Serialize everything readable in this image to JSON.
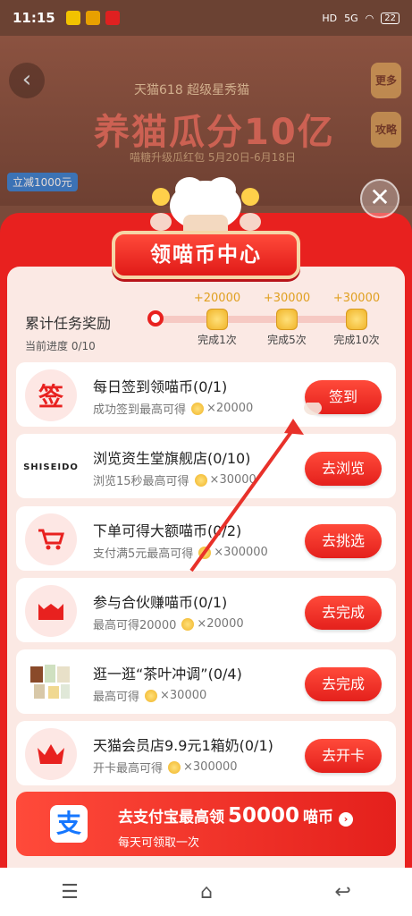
{
  "status_bar": {
    "time": "11:15",
    "network": "5G",
    "battery": "22"
  },
  "banner": {
    "subtitle": "天猫618 超级星秀猫",
    "title": "养猫瓜分10亿",
    "date": "喵糖升级瓜红包 5月20日-6月18日",
    "side_more": "更多",
    "side_strategy": "攻略",
    "discount_tag": "立减1000元"
  },
  "modal": {
    "title": "领喵币中心",
    "progress": {
      "title": "累计任务奖励",
      "current": "当前进度 0/10",
      "milestones": [
        {
          "amount": "+20000",
          "condition": "完成1次"
        },
        {
          "amount": "+30000",
          "condition": "完成5次"
        },
        {
          "amount": "+30000",
          "condition": "完成10次"
        }
      ]
    },
    "tasks": [
      {
        "name": "每日签到领喵币(0/1)",
        "desc": "成功签到最高可得",
        "reward": "×20000",
        "button": "签到",
        "icon": "签"
      },
      {
        "name": "浏览资生堂旗舰店(0/10)",
        "desc": "浏览15秒最高可得",
        "reward": "×30000",
        "button": "去浏览",
        "icon": "SHISEIDO"
      },
      {
        "name": "下单可得大额喵币(0/2)",
        "desc": "支付满5元最高可得",
        "reward": "×300000",
        "button": "去挑选",
        "icon": "cart"
      },
      {
        "name": "参与合伙赚喵币(0/1)",
        "desc": "最高可得20000",
        "reward": "×20000",
        "button": "去完成",
        "icon": "box"
      },
      {
        "name": "逛一逛“茶叶冲调”(0/4)",
        "desc": "最高可得",
        "reward": "×30000",
        "button": "去完成",
        "icon": "tea"
      },
      {
        "name": "天猫会员店9.9元1箱奶(0/1)",
        "desc": "开卡最高可得",
        "reward": "×300000",
        "button": "去开卡",
        "icon": "crown"
      }
    ],
    "alipay": {
      "logo": "支",
      "prefix": "去支付宝最高领",
      "amount": "50000",
      "suffix": "喵币",
      "sub": "每天可领取一次"
    }
  },
  "colors": {
    "primary_red": "#e8211f",
    "coin_gold": "#f0b428",
    "alipay_blue": "#1677ff"
  }
}
